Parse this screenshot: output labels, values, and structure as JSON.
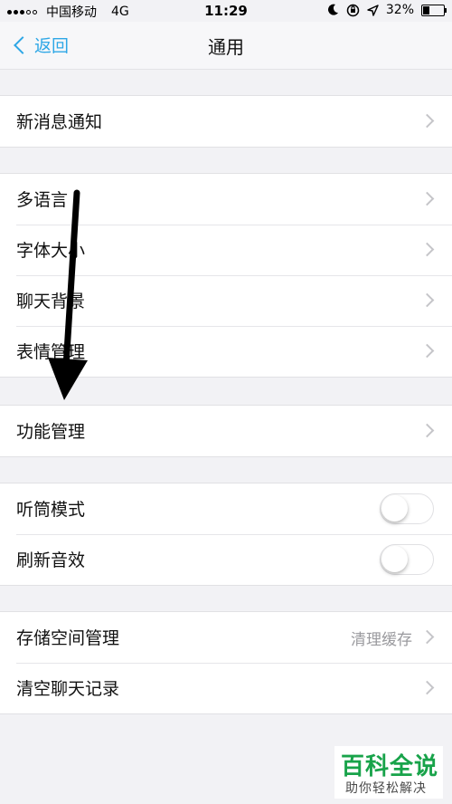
{
  "status_bar": {
    "carrier": "中国移动",
    "network": "4G",
    "time": "11:29",
    "battery": "32%",
    "battery_level": 0.32
  },
  "nav": {
    "back_label": "返回",
    "title": "通用"
  },
  "groups": [
    {
      "rows": [
        {
          "label": "新消息通知",
          "control": "chevron"
        }
      ]
    },
    {
      "rows": [
        {
          "label": "多语言",
          "control": "chevron"
        },
        {
          "label": "字体大小",
          "control": "chevron"
        },
        {
          "label": "聊天背景",
          "control": "chevron"
        },
        {
          "label": "表情管理",
          "control": "chevron"
        }
      ]
    },
    {
      "rows": [
        {
          "label": "功能管理",
          "control": "chevron"
        }
      ]
    },
    {
      "rows": [
        {
          "label": "听筒模式",
          "control": "toggle",
          "on": false
        },
        {
          "label": "刷新音效",
          "control": "toggle",
          "on": false
        }
      ]
    },
    {
      "rows": [
        {
          "label": "存储空间管理",
          "value": "清理缓存",
          "control": "chevron"
        },
        {
          "label": "清空聊天记录",
          "control": "chevron"
        }
      ]
    }
  ],
  "watermark": {
    "title": "百科全说",
    "subtitle": "助你轻松解决"
  },
  "colors": {
    "accent": "#2ea7e6",
    "background": "#f2f2f5",
    "watermark_green": "#18a34a"
  }
}
